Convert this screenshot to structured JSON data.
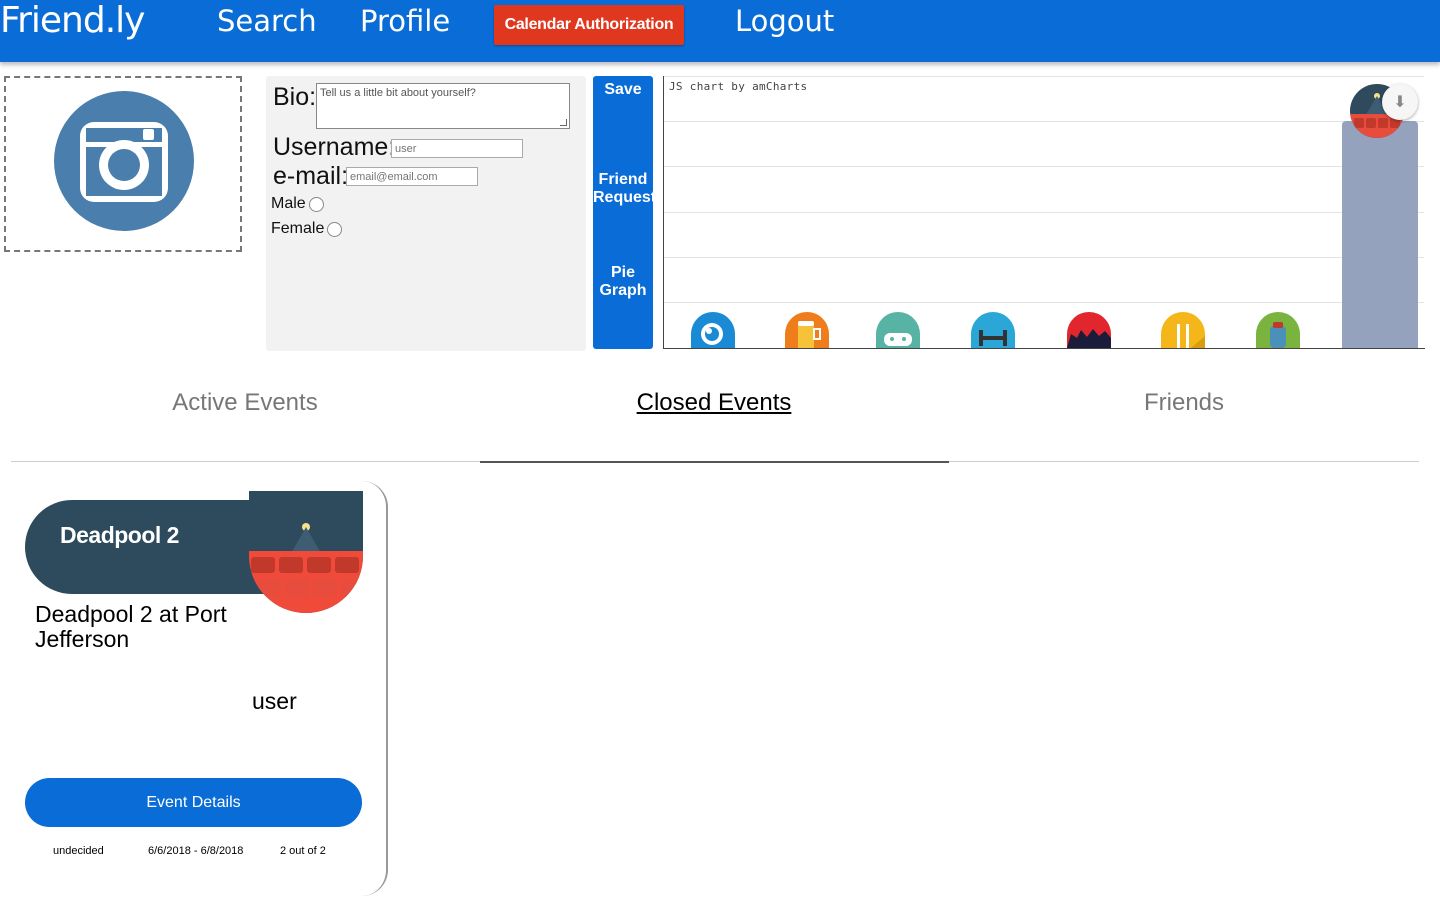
{
  "nav": {
    "brand": "Friend.ly",
    "search": "Search",
    "profile": "Profile",
    "calendar_auth": "Calendar Authorization",
    "logout": "Logout"
  },
  "profile_form": {
    "bio_label": "Bio:",
    "bio_placeholder": "Tell us a little bit about yourself?",
    "username_label": "Username:",
    "username_placeholder": "user",
    "email_label": "e-mail:",
    "email_placeholder": "email@email.com",
    "male_label": "Male",
    "female_label": "Female"
  },
  "side_buttons": {
    "save": "Save",
    "friend_request": "Friend Request",
    "pie_graph": "Pie Graph"
  },
  "chart": {
    "credit": "JS chart by amCharts"
  },
  "chart_data": {
    "type": "bar",
    "categories": [
      "music",
      "drinks",
      "gaming",
      "fitness",
      "concerts",
      "food",
      "outdoors",
      "movies"
    ],
    "values": [
      0,
      0,
      0,
      0,
      0,
      0,
      0,
      1
    ],
    "ylim": [
      0,
      1.2
    ],
    "grid": true
  },
  "tabs": [
    {
      "label": "Active Events"
    },
    {
      "label": "Closed Events"
    },
    {
      "label": "Friends"
    }
  ],
  "event_card": {
    "title": "Deadpool 2",
    "subtitle": "Deadpool 2 at Port Jefferson",
    "host": "user",
    "details_button": "Event Details",
    "status": "undecided",
    "dates": "6/6/2018 - 6/8/2018",
    "attendance": "2 out of 2"
  },
  "colors": {
    "primary": "#0a6cd6",
    "danger": "#e0381f",
    "card_header": "#2e4a5d",
    "bar": "#94a2bd",
    "camera": "#4a7ead"
  }
}
